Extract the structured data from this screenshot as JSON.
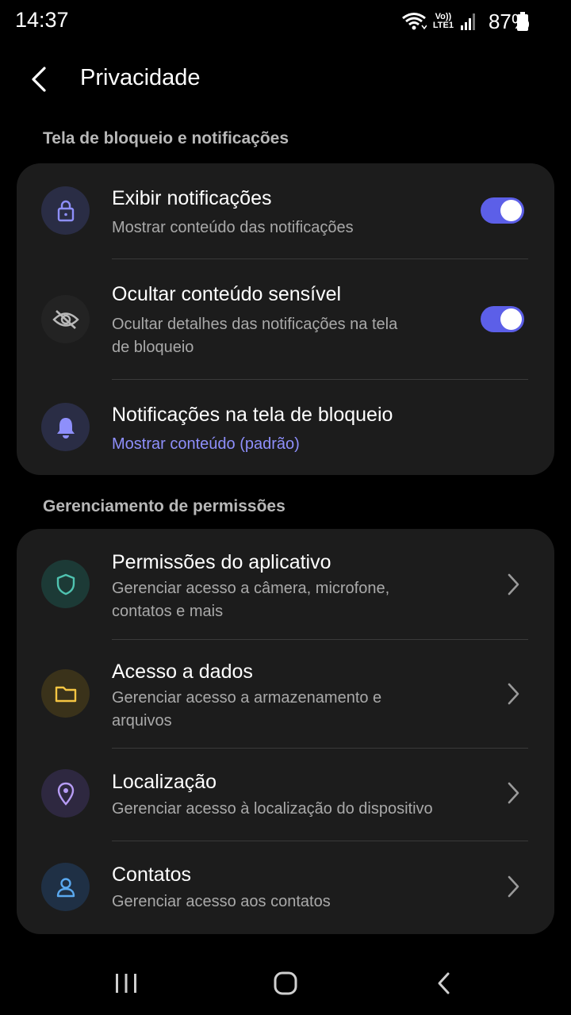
{
  "status_bar": {
    "time": "14:37",
    "volte_top": "Vo))",
    "volte_bottom": "LTE1",
    "battery": "87%"
  },
  "header": {
    "title": "Privacidade"
  },
  "sections": {
    "lock_screen": {
      "title": "Tela de bloqueio e notificações",
      "items": [
        {
          "title": "Exibir notificações",
          "subtitle": "Mostrar conteúdo das notificações",
          "icon": "lock-icon",
          "toggle_on": true
        },
        {
          "title": "Ocultar conteúdo sensível",
          "subtitle": "Ocultar detalhes das notificações na tela de bloqueio",
          "icon": "eye-off-icon",
          "toggle_on": true
        },
        {
          "title": "Notificações na tela de bloqueio",
          "subtitle": "Mostrar conteúdo (padrão)",
          "icon": "bell-icon"
        }
      ]
    },
    "permissions": {
      "title": "Gerenciamento de permissões",
      "items": [
        {
          "title": "Permissões do aplicativo",
          "subtitle": "Gerenciar acesso a câmera, microfone, contatos e mais",
          "icon": "shield-icon"
        },
        {
          "title": "Acesso a dados",
          "subtitle": "Gerenciar acesso a armazenamento e arquivos",
          "icon": "folder-icon"
        },
        {
          "title": "Localização",
          "subtitle": "Gerenciar acesso à localização do dispositivo",
          "icon": "location-pin-icon"
        },
        {
          "title": "Contatos",
          "subtitle": "Gerenciar acesso aos contatos",
          "icon": "person-icon"
        }
      ]
    }
  },
  "colors": {
    "accent": "#5c5fe8",
    "accent_text": "#8e8ffb",
    "card": "#1c1c1c",
    "shield": "#4fc3b0",
    "folder": "#f5c542",
    "location": "#b79cf5",
    "person": "#5aa9f0"
  }
}
